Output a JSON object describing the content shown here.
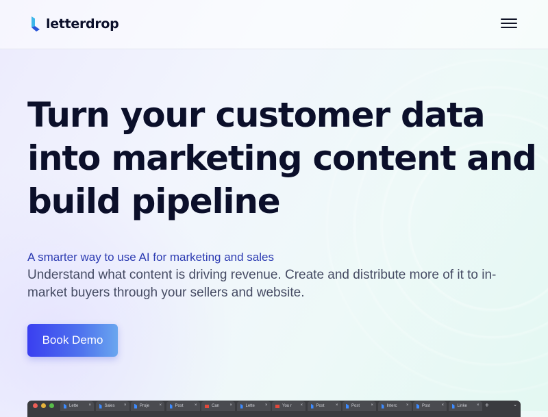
{
  "brand": {
    "name": "letterdrop",
    "colors": {
      "logo_light": "#3fb7ea",
      "logo_dark": "#2a55d8"
    }
  },
  "header": {
    "menu_icon": "hamburger-menu-icon"
  },
  "hero": {
    "headline_lines": [
      "Turn your customer data",
      "into marketing content and",
      "build pipeline"
    ],
    "tagline": "A smarter way to use AI for marketing and sales",
    "description": "Understand what content is driving revenue. Create and distribute more of it to in-market buyers through your sellers and website.",
    "cta_label": "Book Demo",
    "colors": {
      "headline": "#0b0f2a",
      "tagline": "#2d3cb2",
      "cta_start": "#3a3ff0",
      "cta_end": "#6aa6ef"
    }
  },
  "browser_preview": {
    "traffic_light_colors": [
      "#ec5f57",
      "#e6b33c",
      "#58bd4a"
    ],
    "tabs": [
      {
        "label": "Lette",
        "icon": "letterdrop-icon"
      },
      {
        "label": "Sales",
        "icon": "letterdrop-icon"
      },
      {
        "label": "Proje",
        "icon": "letterdrop-icon"
      },
      {
        "label": "Post",
        "icon": "letterdrop-icon"
      },
      {
        "label": "Can",
        "icon": "gmail-icon"
      },
      {
        "label": "Lette",
        "icon": "letterdrop-icon"
      },
      {
        "label": "You r",
        "icon": "gmail-icon"
      },
      {
        "label": "Post",
        "icon": "letterdrop-icon"
      },
      {
        "label": "Post",
        "icon": "letterdrop-icon"
      },
      {
        "label": "Interc",
        "icon": "letterdrop-icon"
      },
      {
        "label": "Post",
        "icon": "letterdrop-icon"
      },
      {
        "label": "Linke",
        "icon": "letterdrop-icon"
      }
    ],
    "new_tab_symbol": "+",
    "close_symbol": "×"
  }
}
